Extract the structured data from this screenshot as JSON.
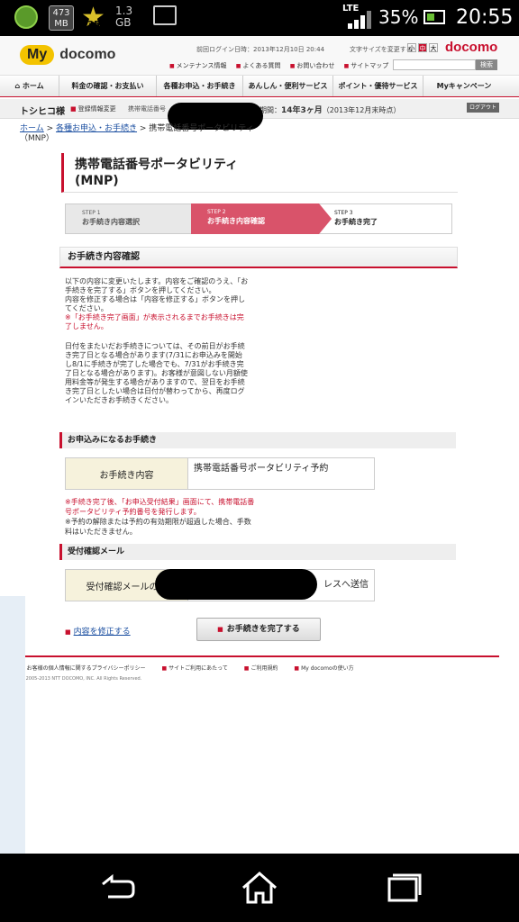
{
  "status_bar": {
    "data_mb": "473\nMB",
    "level_badge": "35",
    "storage": "1.3\nGB",
    "network": "LTE",
    "battery_pct": "35%",
    "time": "20:55"
  },
  "header": {
    "logo_my": "My",
    "logo_docomo": "docomo",
    "last_login": "前回ログイン日時：2013年12月10日 20:44",
    "font_size_label": "文字サイズを変更する",
    "font_sizes": [
      "小",
      "中",
      "大"
    ],
    "brand": "docomo",
    "util_links": [
      "メンテナンス情報",
      "よくある質問",
      "お問い合わせ",
      "サイトマップ"
    ],
    "search_button": "検索"
  },
  "nav": {
    "items": [
      "ホーム",
      "料金の確認・お支払い",
      "各種お申込・お手続き",
      "あんしん・便利サービス",
      "ポイント・優待サービス",
      "Myキャンペーン"
    ]
  },
  "user_bar": {
    "user_name": "トシヒコ様",
    "reg_change": "登録情報変更",
    "phone_label": "携帯電話番号",
    "term_prefix": "期間：",
    "term_value": "14年3ヶ月",
    "term_suffix": "（2013年12月末時点）",
    "logout": "ログアウト"
  },
  "breadcrumb": {
    "home": "ホーム",
    "sep": " > ",
    "section": "各種お申込・お手続き",
    "current": "携帯電話番号ポータビリティ（MNP）"
  },
  "page_title": "携帯電話番号ポータビリティ(MNP)",
  "steps": [
    {
      "no": "STEP 1",
      "label": "お手続き内容選択"
    },
    {
      "no": "STEP 2",
      "label": "お手続き内容確認"
    },
    {
      "no": "STEP 3",
      "label": "お手続き完了"
    }
  ],
  "confirm_section": {
    "heading": "お手続き内容確認",
    "p1": "以下の内容に変更いたします。内容をご確認のうえ、「お手続きを完了する」ボタンを押してください。",
    "p2": "内容を修正する場合は「内容を修正する」ボタンを押してください。",
    "p3_red": "※「お手続き完了画面」が表示されるまでお手続きは完了しません。",
    "p4": "日付をまたいだお手続きについては、その前日がお手続き完了日となる場合があります(7/31にお申込みを開始し8/1に手続きが完了した場合でも、7/31がお手続き完了日となる場合があります)。お客様が意図しない月額使用料金等が発生する場合がありますので、翌日をお手続き完了日としたい場合は日付が替わってから、再度ログインいただきお手続きください。"
  },
  "application": {
    "heading": "お申込みになるお手続き",
    "row_label": "お手続き内容",
    "row_value": "携帯電話番号ポータビリティ予約",
    "note_red": "※手続き完了後、「お申込受付結果」画面にて、携帯電話番号ポータビリティ予約番号を発行します。",
    "note": "※予約の解除または予約の有効期限が超過した場合、手数料はいただきません。"
  },
  "email": {
    "heading": "受付確認メール",
    "row_label": "受付確認メールの送",
    "row_value": "レスへ送信"
  },
  "actions": {
    "modify": "内容を修正する",
    "complete": "お手続きを完了する"
  },
  "footer": {
    "links": [
      "お客様の個人情報に関するプライバシーポリシー",
      "サイトご利用にあたって",
      "ご利用規約",
      "My docomoの使い方"
    ],
    "copyright": "© 2005-2013 NTT DOCOMO, INC. All Rights Reserved."
  }
}
